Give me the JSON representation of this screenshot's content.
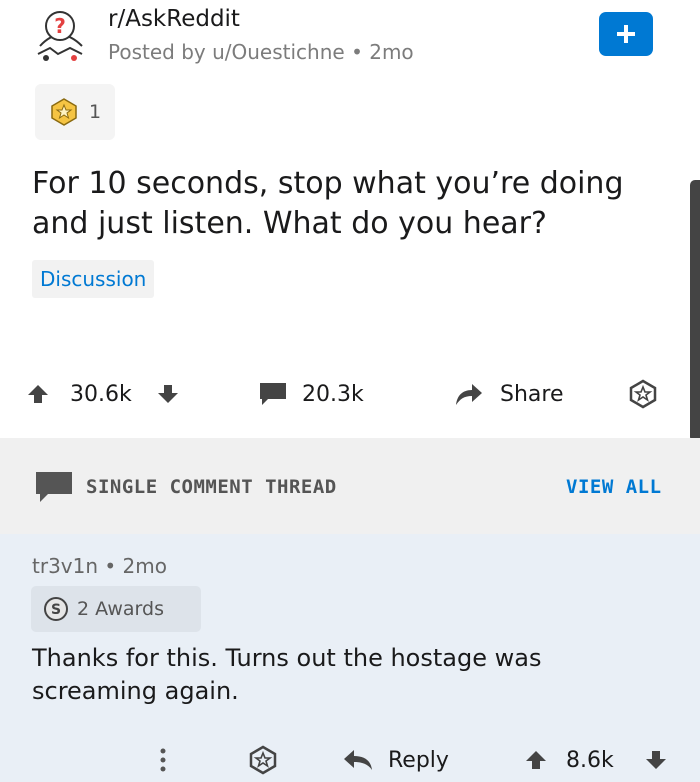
{
  "post": {
    "subreddit": "r/AskReddit",
    "posted_by": "Posted by u/Ouestichne",
    "age": "2mo",
    "award_count": "1",
    "title": "For 10 seconds, stop what you’re doing and just listen. What do you hear?",
    "flair": "Discussion",
    "upvotes": "30.6k",
    "comments": "20.3k",
    "share_label": "Share",
    "join_icon": "plus-icon"
  },
  "thread": {
    "label": "SINGLE COMMENT THREAD",
    "view_all": "VIEW ALL"
  },
  "comment": {
    "author": "tr3v1n",
    "age": "2mo",
    "awards": "2 Awards",
    "body": "Thanks for this. Turns out the hostage was screaming again.",
    "reply_label": "Reply",
    "upvotes": "8.6k"
  },
  "colors": {
    "accent": "#0079d3",
    "comment_bg": "#e9eff6",
    "thread_bar_bg": "#f0f0f0"
  }
}
